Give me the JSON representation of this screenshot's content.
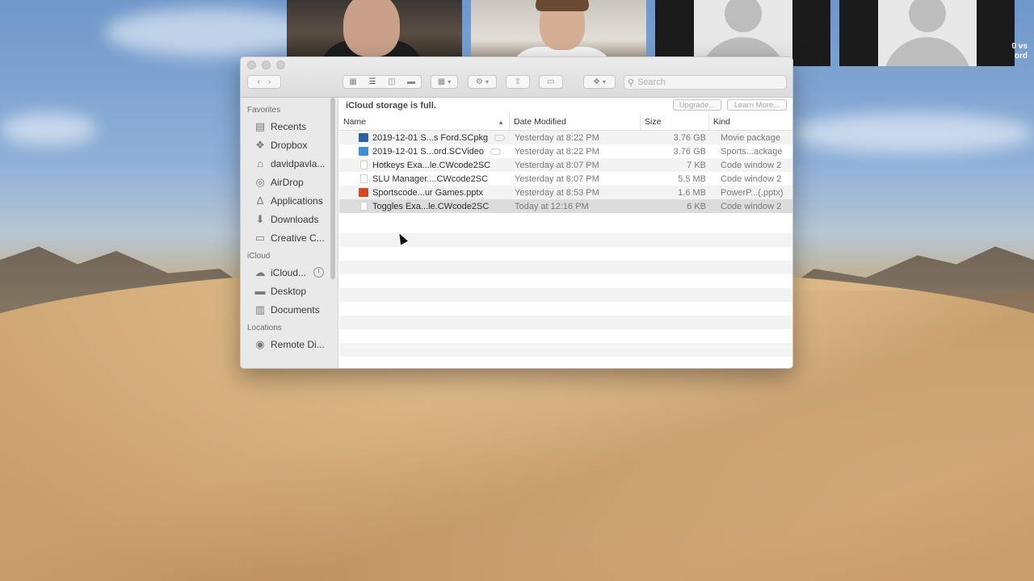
{
  "video_call": {
    "edge_text_line1": "0 vs",
    "edge_text_line2": "ord"
  },
  "finder": {
    "search_placeholder": "Search",
    "banner": {
      "message": "iCloud storage is full.",
      "upgrade_label": "Upgrade...",
      "learn_more_label": "Learn More..."
    },
    "sidebar": {
      "favorites_heading": "Favorites",
      "favorites": [
        {
          "label": "Recents",
          "icon": "recents-icon"
        },
        {
          "label": "Dropbox",
          "icon": "dropbox-icon"
        },
        {
          "label": "davidpavla...",
          "icon": "home-icon"
        },
        {
          "label": "AirDrop",
          "icon": "airdrop-icon"
        },
        {
          "label": "Applications",
          "icon": "applications-icon"
        },
        {
          "label": "Downloads",
          "icon": "downloads-icon"
        },
        {
          "label": "Creative C...",
          "icon": "folder-icon"
        }
      ],
      "icloud_heading": "iCloud",
      "icloud": [
        {
          "label": "iCloud...",
          "icon": "icloud-drive-icon"
        },
        {
          "label": "Desktop",
          "icon": "desktop-icon"
        },
        {
          "label": "Documents",
          "icon": "documents-icon"
        }
      ],
      "locations_heading": "Locations",
      "locations": [
        {
          "label": "Remote Di...",
          "icon": "remote-disc-icon"
        }
      ]
    },
    "columns": {
      "name": "Name",
      "date_modified": "Date Modified",
      "size": "Size",
      "kind": "Kind"
    },
    "files": [
      {
        "name": "2019-12-01 S...s Ford.SCpkg",
        "date": "Yesterday at 8:22 PM",
        "size": "3.76 GB",
        "kind": "Movie package",
        "icon_color": "#2f5f9e",
        "cloud": true
      },
      {
        "name": "2019-12-01 S...ord.SCVideo",
        "date": "Yesterday at 8:22 PM",
        "size": "3.76 GB",
        "kind": "Sports...ackage",
        "icon_color": "#3a8fd6",
        "cloud": true
      },
      {
        "name": "Hotkeys Exa...le.CWcode2SC",
        "date": "Yesterday at 8:07 PM",
        "size": "7 KB",
        "kind": "Code window 2",
        "icon_color": "#ffffff",
        "cloud": false
      },
      {
        "name": "SLU Manager....CWcode2SC",
        "date": "Yesterday at 8:07 PM",
        "size": "5.5 MB",
        "kind": "Code window 2",
        "icon_color": "#ffffff",
        "cloud": false
      },
      {
        "name": "Sportscode...ur Games.pptx",
        "date": "Yesterday at 8:53 PM",
        "size": "1.6 MB",
        "kind": "PowerP...(.pptx)",
        "icon_color": "#d24726",
        "cloud": false
      },
      {
        "name": "Toggles Exa...le.CWcode2SC",
        "date": "Today at 12:16 PM",
        "size": "6 KB",
        "kind": "Code window 2",
        "icon_color": "#ffffff",
        "cloud": false,
        "selected": true
      }
    ]
  }
}
